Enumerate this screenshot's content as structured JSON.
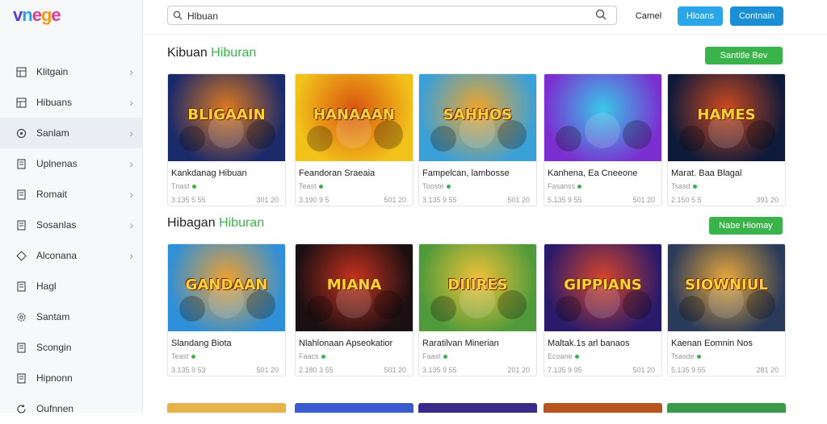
{
  "app": {
    "logo": "vnege"
  },
  "sidebar": {
    "items": [
      {
        "label": "Klitgain",
        "icon": "grid-icon",
        "active": false
      },
      {
        "label": "Hibuans",
        "icon": "grid-icon",
        "active": false
      },
      {
        "label": "Sanlam",
        "icon": "circle-icon",
        "active": true
      },
      {
        "label": "Uplnenas",
        "icon": "doc-icon",
        "active": false
      },
      {
        "label": "Romait",
        "icon": "doc-icon",
        "active": false
      },
      {
        "label": "Sosanlas",
        "icon": "doc-icon",
        "active": false
      },
      {
        "label": "Alconana",
        "icon": "diamond-icon",
        "active": false
      },
      {
        "label": "Hagl",
        "icon": "doc-icon",
        "active": false
      },
      {
        "label": "Santam",
        "icon": "gear-icon",
        "active": false
      },
      {
        "label": "Scongin",
        "icon": "doc-icon",
        "active": false
      },
      {
        "label": "Hipnonn",
        "icon": "doc-icon",
        "active": false
      },
      {
        "label": "Oufnnen",
        "icon": "refresh-icon",
        "active": false
      }
    ]
  },
  "search": {
    "value": "Hlbuan",
    "placeholder": ""
  },
  "toolbar": {
    "plain_label": "Carnel",
    "light_label": "Hloans",
    "dark_label": "Contnain"
  },
  "sections": [
    {
      "title": "Kibuan",
      "title_accent": "Hiburan",
      "button": "Santitle Bev",
      "cards": [
        {
          "thumb": "BLIGAAIN",
          "title": "Kankdanag Hibuan",
          "sub": "Tnast",
          "left": "3.135 5 55",
          "right": "301 20",
          "color1": "#1b2a6b",
          "color2": "#e07a1d"
        },
        {
          "thumb": "HANAAAN",
          "title": "Feandoran Sraeaia",
          "sub": "Teast",
          "left": "3.190 9 5",
          "right": "501 20",
          "color1": "#f2c21a",
          "color2": "#d8540f"
        },
        {
          "thumb": "SAHHOS",
          "title": "Fampelcan, lambosse",
          "sub": "Tooste",
          "left": "3.135 9 55",
          "right": "501 20",
          "color1": "#3aa0d8",
          "color2": "#f0a52a"
        },
        {
          "thumb": "",
          "title": "Kanhena, Ea Cneeone",
          "sub": "Fasanss",
          "left": "5.135 9 55",
          "right": "501 20",
          "color1": "#7b2fd0",
          "color2": "#38c8e8"
        },
        {
          "thumb": "HAMES",
          "title": "Marat. Baa Blagal",
          "sub": "Tsasd",
          "left": "2.150 5 5",
          "right": "391 20",
          "color1": "#0e1a3a",
          "color2": "#d04a1e"
        }
      ]
    },
    {
      "title": "Hibagan",
      "title_accent": "Hiburan",
      "button": "Nabe Hiomay",
      "cards": [
        {
          "thumb": "GANDAAN",
          "title": "Slandang Biota",
          "sub": "Teast",
          "left": "3.135 9 53",
          "right": "501 20",
          "color1": "#2f8fd8",
          "color2": "#f0a030"
        },
        {
          "thumb": "MIANA",
          "title": "Nlahlonaan Apseokatior",
          "sub": "Faacs",
          "left": "2.180 3 55",
          "right": "501 20",
          "color1": "#1a0f12",
          "color2": "#c8321e"
        },
        {
          "thumb": "DIIIRES",
          "title": "Raratilvan Minerian",
          "sub": "Faast",
          "left": "3.135 9 55",
          "right": "201 20",
          "color1": "#4f9a3a",
          "color2": "#f2c23a"
        },
        {
          "thumb": "GIPPIANS",
          "title": "Maltak.1s arl banaos",
          "sub": "Ecoane",
          "left": "7.135 9 95",
          "right": "501 20",
          "color1": "#2a1a6a",
          "color2": "#d8452a"
        },
        {
          "thumb": "SIOWNIUL",
          "title": "Kaenan Eomnin Nos",
          "sub": "Tsasde",
          "left": "5.135 9 55",
          "right": "281 20",
          "color1": "#2a3a5a",
          "color2": "#e8a83a"
        }
      ]
    }
  ],
  "bottom_strip_colors": [
    "#e8b24a",
    "#3a5ad0",
    "#3a2a8a",
    "#b8541e",
    "#3a9a4a"
  ]
}
